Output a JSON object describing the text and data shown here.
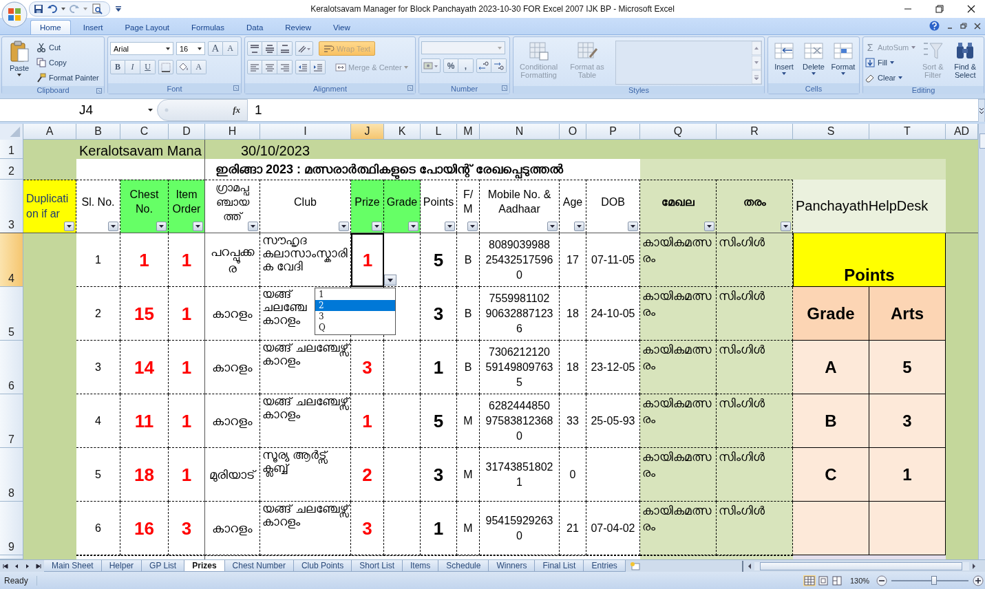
{
  "window": {
    "title": "Keralotsavam Manager for Block Panchayath 2023-10-30 FOR Excel 2007 IJK BP  -  Microsoft Excel"
  },
  "ribbon_tabs": [
    {
      "label": "Home",
      "selected": true
    },
    {
      "label": "Insert",
      "selected": false
    },
    {
      "label": "Page Layout",
      "selected": false
    },
    {
      "label": "Formulas",
      "selected": false
    },
    {
      "label": "Data",
      "selected": false
    },
    {
      "label": "Review",
      "selected": false
    },
    {
      "label": "View",
      "selected": false
    }
  ],
  "ribbon": {
    "clipboard": {
      "label": "Clipboard",
      "paste": "Paste",
      "cut": "Cut",
      "copy": "Copy",
      "format_painter": "Format Painter"
    },
    "font": {
      "label": "Font",
      "font_name": "Arial",
      "font_size": "16",
      "grow": "A",
      "shrink": "A",
      "bold": "B",
      "italic": "I",
      "underline": "U",
      "font_color": "A"
    },
    "alignment": {
      "label": "Alignment",
      "wrap_text": {
        "label": "Wrap Text",
        "on": true,
        "disabled": true
      },
      "merge_center": {
        "label": "Merge & Center",
        "disabled": true
      }
    },
    "number": {
      "label": "Number",
      "percent": "%",
      "comma": ","
    },
    "styles": {
      "label": "Styles",
      "buttons": [
        {
          "label": "Conditional Formatting",
          "disabled": true
        },
        {
          "label": "Format as Table",
          "disabled": true
        }
      ]
    },
    "cells": {
      "label": "Cells",
      "buttons": [
        {
          "label": "Insert",
          "disabled": false
        },
        {
          "label": "Delete",
          "disabled": false
        },
        {
          "label": "Format",
          "disabled": false
        }
      ]
    },
    "editing": {
      "label": "Editing",
      "sigma": "Σ",
      "autosum": {
        "label": "AutoSum",
        "disabled": true
      },
      "fill": "Fill",
      "clear": "Clear",
      "sort_filter": {
        "label": "Sort & Filter",
        "disabled": true
      },
      "find_select": "Find & Select"
    }
  },
  "formula_bar": {
    "name_box": "J4",
    "function_label": "fx",
    "value": "1"
  },
  "sheet": {
    "columns": [
      {
        "label": "A",
        "selected": false
      },
      {
        "label": "B",
        "selected": false
      },
      {
        "label": "C",
        "selected": false
      },
      {
        "label": "D",
        "selected": false
      },
      {
        "label": "H",
        "selected": false
      },
      {
        "label": "I",
        "selected": false
      },
      {
        "label": "J",
        "selected": true
      },
      {
        "label": "K",
        "selected": false
      },
      {
        "label": "L",
        "selected": false
      },
      {
        "label": "M",
        "selected": false
      },
      {
        "label": "N",
        "selected": false
      },
      {
        "label": "O",
        "selected": false
      },
      {
        "label": "P",
        "selected": false
      },
      {
        "label": "Q",
        "selected": false
      },
      {
        "label": "R",
        "selected": false
      },
      {
        "label": "S",
        "selected": false
      },
      {
        "label": "T",
        "selected": false
      },
      {
        "label": "AD",
        "selected": false
      }
    ],
    "row_headers": [
      {
        "label": "1",
        "selected": false
      },
      {
        "label": "2",
        "selected": false
      },
      {
        "label": "3",
        "selected": false
      },
      {
        "label": "4",
        "selected": true
      },
      {
        "label": "5",
        "selected": false
      },
      {
        "label": "6",
        "selected": false
      },
      {
        "label": "7",
        "selected": false
      },
      {
        "label": "8",
        "selected": false
      },
      {
        "label": "9",
        "selected": false
      }
    ],
    "title": "Keralotsavam Mana",
    "date": "30/10/2023",
    "heading": "ഇരിങ്ങാ 2023 :  മത്സരാർത്ഥികളുടെ പോയിന്റ് രേഖപ്പെടുത്തൽ",
    "headers": [
      {
        "label": "Duplication if ar",
        "color": "#ffff00"
      },
      {
        "label": "Sl. No.",
        "color": "#ffffff"
      },
      {
        "label": "Chest No.",
        "color": "#66ff66"
      },
      {
        "label": "Item Order",
        "color": "#66ff66"
      },
      {
        "label": "ഗ്രാമപ്പഞ്ചായത്ത്",
        "color": "#ffffff"
      },
      {
        "label": "Club",
        "color": "#ffffff"
      },
      {
        "label": "Prize",
        "color": "#66ff66"
      },
      {
        "label": "Grade",
        "color": "#66ff66"
      },
      {
        "label": "Points",
        "color": "#ffffff"
      },
      {
        "label": "F/ M",
        "color": "#ffffff"
      },
      {
        "label": "Mobile No. & Aadhaar",
        "color": "#ffffff"
      },
      {
        "label": "Age",
        "color": "#ffffff"
      },
      {
        "label": "DOB",
        "color": "#ffffff"
      },
      {
        "label": "മേഖല",
        "color": "#d8e4bc"
      },
      {
        "label": "തരം",
        "color": "#d8e4bc"
      }
    ],
    "helpdesk": "PanchayathHelpDesk",
    "rows": [
      {
        "sl": "1",
        "chest": "1",
        "order": "1",
        "panchayath": "പറപ്പൂക്കര",
        "club": "സൗഹൃദ കലാസാംസ്കാരിക വേദി",
        "prize": "1",
        "points": "5",
        "gender": "B",
        "mobile": "8089039988 254325175960",
        "age": "17",
        "dob": "07-11-05",
        "zone": "കായികമത്സരം",
        "type": "സിംഗിൾ"
      },
      {
        "sl": "2",
        "chest": "15",
        "order": "1",
        "panchayath": "കാറളം",
        "club": "യങ്ങ്\nചലഞ്ചേ\nകാറളം",
        "points": "3",
        "gender": "B",
        "mobile": "7559981102 906328871236",
        "age": "18",
        "dob": "24-10-05",
        "zone": "കായികമത്സരം",
        "type": "സിംഗിൾ"
      },
      {
        "sl": "3",
        "chest": "14",
        "order": "1",
        "panchayath": "കാറളം",
        "club": "യങ്ങ് ചലഞ്ചേഴ്സ് കാറളം",
        "prize": "3",
        "points": "1",
        "gender": "B",
        "mobile": "7306212120 591498097635",
        "age": "18",
        "dob": "23-12-05",
        "zone": "കായികമത്സരം",
        "type": "സിംഗിൾ"
      },
      {
        "sl": "4",
        "chest": "11",
        "order": "1",
        "panchayath": "കാറളം",
        "club": "യങ്ങ് ചലഞ്ചേഴ്സ് കാറളം",
        "prize": "1",
        "points": "5",
        "gender": "M",
        "mobile": "6282444850 975838123680",
        "age": "33",
        "dob": "25-05-93",
        "zone": "കായികമത്സരം",
        "type": "സിംഗിൾ"
      },
      {
        "sl": "5",
        "chest": "18",
        "order": "1",
        "panchayath": "മുരിയാട്",
        "club": "സൂര്യ ആർട്സ് ക്ലബ്ബ്",
        "prize": "2",
        "points": "3",
        "gender": "M",
        "mobile": "317438518021",
        "age": "0",
        "zone": "കായികമത്സരം",
        "type": "സിംഗിൾ"
      },
      {
        "sl": "6",
        "chest": "16",
        "order": "3",
        "panchayath": "കാറളം",
        "club": "യങ്ങ് ചലഞ്ചേഴ്സ് കാറളം",
        "prize": "3",
        "points": "1",
        "gender": "M",
        "mobile": "954159292630",
        "age": "21",
        "dob": "07-04-02",
        "zone": "കായികമത്സരം",
        "type": "സിംഗിൾ"
      }
    ],
    "points_table": {
      "title": "Points",
      "header": [
        "Grade",
        "Arts"
      ],
      "rows": [
        [
          "A",
          "5"
        ],
        [
          "B",
          "3"
        ],
        [
          "C",
          "1"
        ]
      ]
    },
    "dropdown": {
      "items": [
        {
          "label": "1",
          "selected": false
        },
        {
          "label": "2",
          "selected": true
        },
        {
          "label": "3",
          "selected": false
        },
        {
          "label": "Q",
          "selected": false
        }
      ]
    }
  },
  "sheet_tabs": [
    {
      "label": "Main Sheet",
      "selected": false
    },
    {
      "label": "Helper",
      "selected": false
    },
    {
      "label": "GP List",
      "selected": false
    },
    {
      "label": "Prizes",
      "selected": true
    },
    {
      "label": "Chest Number",
      "selected": false
    },
    {
      "label": "Club Points",
      "selected": false
    },
    {
      "label": "Short List",
      "selected": false
    },
    {
      "label": "Items",
      "selected": false
    },
    {
      "label": "Schedule",
      "selected": false
    },
    {
      "label": "Winners",
      "selected": false
    },
    {
      "label": "Final List",
      "selected": false
    },
    {
      "label": "Entries",
      "selected": false
    }
  ],
  "status_bar": {
    "status": "Ready",
    "zoom": "130%",
    "zoom_slider": {
      "level": 0.55
    }
  }
}
